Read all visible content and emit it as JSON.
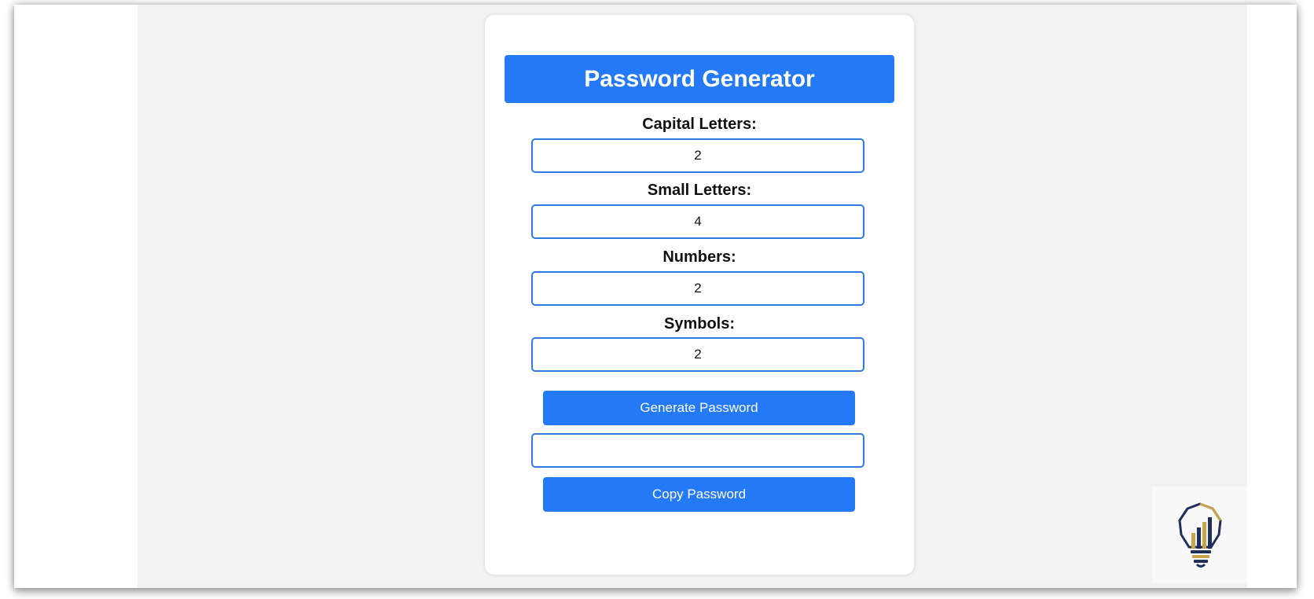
{
  "app": {
    "title": "Password Generator"
  },
  "fields": [
    {
      "label": "Capital Letters:",
      "value": "2"
    },
    {
      "label": "Small Letters:",
      "value": "4"
    },
    {
      "label": "Numbers:",
      "value": "2"
    },
    {
      "label": "Symbols:",
      "value": "2"
    }
  ],
  "buttons": {
    "generate": "Generate Password",
    "copy": "Copy Password"
  },
  "output": {
    "value": ""
  },
  "colors": {
    "accent": "#2479f6",
    "input_border": "#2f7be0",
    "page_background": "#f2f2f2",
    "logo_gold": "#c9a54a",
    "logo_navy": "#1f2f5a"
  },
  "icons": {
    "logo": "lightbulb-bar-chart-logo"
  }
}
